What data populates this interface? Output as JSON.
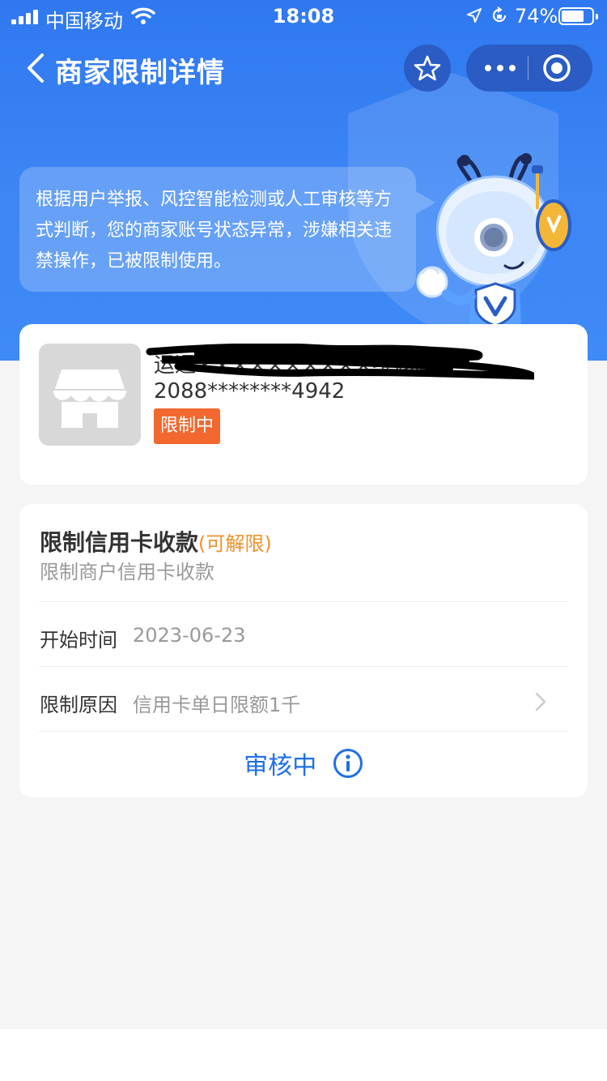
{
  "status_bar": {
    "carrier": "中国移动",
    "time": "18:08",
    "battery_percent": "74%",
    "battery_level": 0.74
  },
  "nav": {
    "title": "商家限制详情",
    "icons": [
      "back-icon",
      "star-icon",
      "more-icon",
      "target-icon"
    ]
  },
  "notice": {
    "text": "根据用户举报、风控智能检测或人工审核等方式判断，您的商家账号状态异常，涉嫌相关违禁操作，已被限制使用。"
  },
  "merchant": {
    "name": "运通××××××××××维修店",
    "account_id": "2088********4942",
    "status": "限制中",
    "status_color": "#f2682f"
  },
  "restriction": {
    "title": "限制信用卡收款",
    "tag": "(可解限)",
    "subtitle": "限制商户信用卡收款",
    "start_label": "开始时间",
    "start_value": "2023-06-23",
    "reason_label": "限制原因",
    "reason_value": "信用卡单日限额1千",
    "review_status": "审核中"
  },
  "colors": {
    "brand_blue": "#3c86f5",
    "link_blue": "#1f6fe8",
    "tag_orange": "#f0912a"
  }
}
